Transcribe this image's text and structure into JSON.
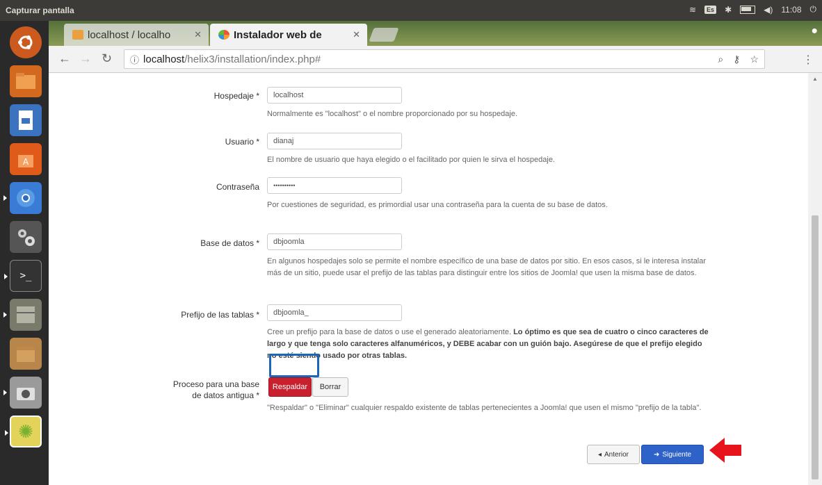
{
  "system": {
    "app_title": "Capturar pantalla",
    "keyboard_layout": "Es",
    "clock": "11:08"
  },
  "launcher": {
    "items": [
      {
        "name": "ubuntu-dash",
        "icon": "ubuntu-logo-icon",
        "color": "#cc5a1f"
      },
      {
        "name": "files",
        "icon": "folder-icon",
        "color": "#d2691e"
      },
      {
        "name": "libreoffice-writer",
        "icon": "document-icon",
        "color": "#3b73c0"
      },
      {
        "name": "software-center",
        "icon": "shopping-bag-icon",
        "color": "#e05a1a"
      },
      {
        "name": "chromium",
        "icon": "browser-icon",
        "color": "#3a7bd5"
      },
      {
        "name": "system-settings",
        "icon": "gear-icon",
        "color": "#555"
      },
      {
        "name": "terminal",
        "icon": "terminal-icon",
        "color": "#333"
      },
      {
        "name": "archive-manager",
        "icon": "archive-icon",
        "color": "#7a7a6a"
      },
      {
        "name": "package",
        "icon": "box-icon",
        "color": "#b8864b"
      },
      {
        "name": "camera",
        "icon": "camera-icon",
        "color": "#9a9a9a"
      },
      {
        "name": "screenshot",
        "icon": "sun-icon",
        "color": "#e3d35a"
      }
    ]
  },
  "browser": {
    "tabs": [
      {
        "title": "localhost / localho",
        "state": "inactive"
      },
      {
        "title": "Instalador web de",
        "state": "active"
      }
    ],
    "url_host": "localhost",
    "url_path": "/helix3/installation/index.php#"
  },
  "form": {
    "host": {
      "label": "Hospedaje *",
      "value": "localhost",
      "help": "Normalmente es \"localhost\" o el nombre proporcionado por su hospedaje."
    },
    "user": {
      "label": "Usuario *",
      "value": "dianaj",
      "help": "El nombre de usuario que haya elegido o el facilitado por quien le sirva el hospedaje."
    },
    "password": {
      "label": "Contraseña",
      "value": "••••••••••",
      "help": "Por cuestiones de seguridad, es primordial usar una contraseña para la cuenta de su base de datos."
    },
    "database": {
      "label": "Base de datos *",
      "value": "dbjoomla",
      "help": "En algunos hospedajes solo se permite el nombre específico de una base de datos por sitio. En esos casos, si le interesa instalar más de un sitio, puede usar el prefijo de las tablas para distinguir entre los sitios de Joomla! que usen la misma base de datos."
    },
    "prefix": {
      "label": "Prefijo de las tablas *",
      "value": "dbjoomla_",
      "help_plain": "Cree un prefijo para la base de datos o use el generado aleatoriamente. ",
      "help_bold": "Lo óptimo es que sea de cuatro o cinco caracteres de largo y que tenga solo caracteres alfanuméricos, y DEBE acabar con un guión bajo. Asegúrese de que el prefijo elegido no esté siendo usado por otras tablas."
    },
    "old_db": {
      "label_line1": "Proceso para una base",
      "label_line2": "de datos antigua *",
      "option_backup": "Respaldar",
      "option_delete": "Borrar",
      "help": "\"Respaldar\" o \"Eliminar\" cualquier respaldo existente de tablas pertenecientes a Joomla! que usen el mismo \"prefijo de la tabla\"."
    }
  },
  "nav_buttons": {
    "previous": "Anterior",
    "next": "Siguiente"
  },
  "colors": {
    "danger": "#c9202e",
    "primary": "#2f62c9",
    "highlight": "#1a66b8",
    "annotation_arrow": "#e8141b"
  }
}
